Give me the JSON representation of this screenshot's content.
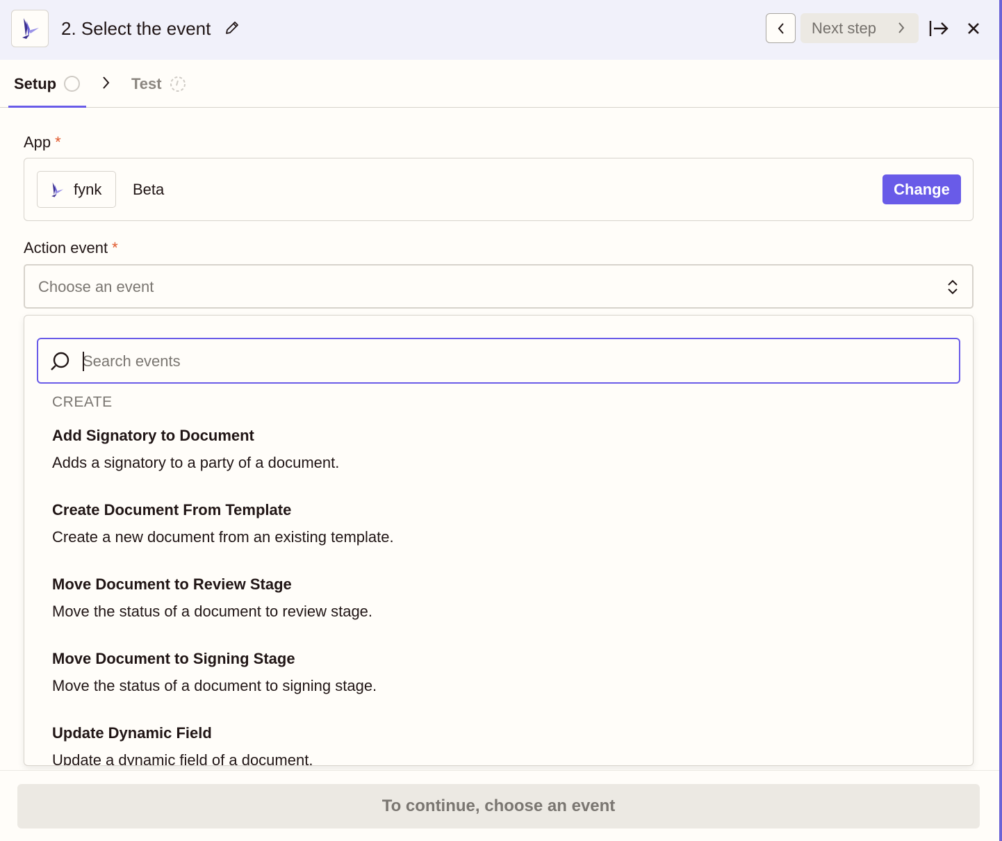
{
  "header": {
    "title": "2. Select the event",
    "next_step_label": "Next step"
  },
  "tabs": [
    {
      "label": "Setup"
    },
    {
      "label": "Test"
    }
  ],
  "app_field": {
    "label": "App",
    "required_mark": "*",
    "app_name": "fynk",
    "badge": "Beta",
    "change_label": "Change"
  },
  "event_field": {
    "label": "Action event",
    "required_mark": "*",
    "placeholder": "Choose an event"
  },
  "dropdown": {
    "search_placeholder": "Search events",
    "group_heading": "CREATE",
    "items": [
      {
        "title": "Add Signatory to Document",
        "description": "Adds a signatory to a party of a document."
      },
      {
        "title": "Create Document From Template",
        "description": "Create a new document from an existing template."
      },
      {
        "title": "Move Document to Review Stage",
        "description": "Move the status of a document to review stage."
      },
      {
        "title": "Move Document to Signing Stage",
        "description": "Move the status of a document to signing stage."
      },
      {
        "title": "Update Dynamic Field",
        "description": "Update a dynamic field of a document."
      }
    ]
  },
  "footer": {
    "continue_label": "To continue, choose an event"
  },
  "colors": {
    "accent": "#695be8",
    "required": "#e0572b",
    "header_bg": "#f1f1fa"
  }
}
